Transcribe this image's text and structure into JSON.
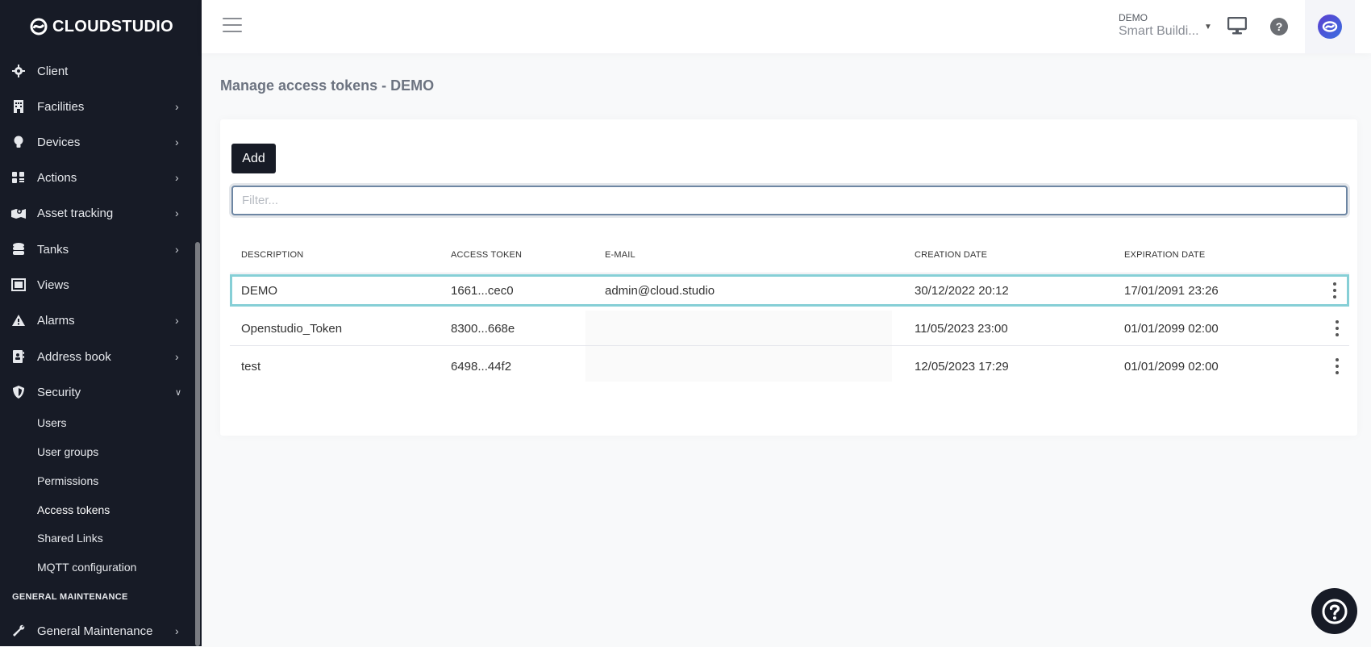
{
  "brand": {
    "name": "CLOUDSTUDIO"
  },
  "sidebar": {
    "items": [
      {
        "label": "Client",
        "icon": "gear-icon",
        "has_submenu": false
      },
      {
        "label": "Facilities",
        "icon": "building-icon",
        "has_submenu": true
      },
      {
        "label": "Devices",
        "icon": "lightbulb-icon",
        "has_submenu": true
      },
      {
        "label": "Actions",
        "icon": "grid-icon",
        "has_submenu": true
      },
      {
        "label": "Asset tracking",
        "icon": "map-icon",
        "has_submenu": true
      },
      {
        "label": "Tanks",
        "icon": "database-icon",
        "has_submenu": true
      },
      {
        "label": "Views",
        "icon": "image-icon",
        "has_submenu": false
      },
      {
        "label": "Alarms",
        "icon": "warning-icon",
        "has_submenu": true
      },
      {
        "label": "Address book",
        "icon": "contact-book-icon",
        "has_submenu": true
      },
      {
        "label": "Security",
        "icon": "shield-icon",
        "has_submenu": true,
        "expanded": true
      }
    ],
    "security_subitems": [
      {
        "label": "Users"
      },
      {
        "label": "User groups"
      },
      {
        "label": "Permissions"
      },
      {
        "label": "Access tokens",
        "active": true
      },
      {
        "label": "Shared Links"
      },
      {
        "label": "MQTT configuration"
      }
    ],
    "section_general": "GENERAL MAINTENANCE",
    "general_item": {
      "label": "General Maintenance",
      "icon": "wrench-icon"
    }
  },
  "header": {
    "org": "DEMO",
    "context": "Smart Buildi...",
    "icons": [
      "menu-icon",
      "monitor-icon",
      "help-icon",
      "avatar"
    ]
  },
  "page": {
    "title": "Manage access tokens - DEMO",
    "add_label": "Add",
    "filter_placeholder": "Filter...",
    "filter_value": ""
  },
  "table": {
    "columns": [
      "DESCRIPTION",
      "ACCESS TOKEN",
      "E-MAIL",
      "CREATION DATE",
      "EXPIRATION DATE"
    ],
    "rows": [
      {
        "description": "DEMO",
        "token": "1661...cec0",
        "email": "admin@cloud.studio",
        "created": "30/12/2022 20:12",
        "expires": "17/01/2091 23:26",
        "selected": true
      },
      {
        "description": "Openstudio_Token",
        "token": "8300...668e",
        "email": "",
        "created": "11/05/2023 23:00",
        "expires": "01/01/2099 02:00"
      },
      {
        "description": "test",
        "token": "6498...44f2",
        "email": "",
        "created": "12/05/2023 17:29",
        "expires": "01/01/2099 02:00"
      }
    ]
  },
  "colors": {
    "sidebar_bg": "#171b26",
    "selected_row_border": "#86cfd6",
    "accent": "#171b26"
  }
}
